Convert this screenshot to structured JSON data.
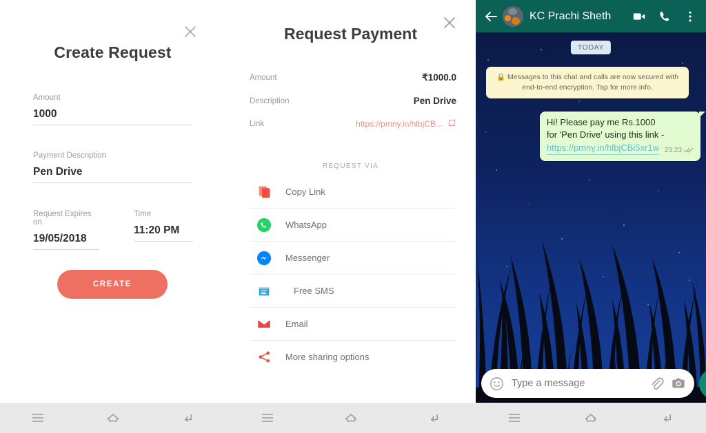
{
  "panel_create_request": {
    "title": "Create Request",
    "close_icon": "close-icon",
    "fields": [
      {
        "label": "Amount",
        "value": "1000"
      },
      {
        "label": "Payment Description",
        "value": "Pen Drive"
      },
      {
        "label": "Request Expires on",
        "value": "19/05/2018"
      },
      {
        "label": "Time",
        "value": "11:20 PM"
      }
    ],
    "submit_label": "CREATE",
    "accent_color": "#ef6f61"
  },
  "panel_request_payment": {
    "title": "Request Payment",
    "close_icon": "close-icon",
    "details": [
      {
        "label": "Amount",
        "value": "₹1000.0"
      },
      {
        "label": "Description",
        "value": "Pen Drive"
      },
      {
        "label": "Link",
        "value": "https://pmny.in/hlbjCB...",
        "icon": "external-link-icon"
      }
    ],
    "section_label": "REQUEST VIA",
    "share_options": [
      {
        "label": "Copy Link",
        "icon": "copy-icon",
        "color": "#ef6f61"
      },
      {
        "label": "WhatsApp",
        "icon": "whatsapp-icon",
        "color": "#25d366"
      },
      {
        "label": "Messenger",
        "icon": "messenger-icon",
        "color": "#0084ff"
      },
      {
        "label": "Free SMS",
        "icon": "sms-icon",
        "color": "#2aa8e8"
      },
      {
        "label": "Email",
        "icon": "gmail-icon",
        "color": "#e8453c"
      },
      {
        "label": "More sharing options",
        "icon": "share-icon",
        "color": "#ef4b3c"
      }
    ],
    "link_color": "#ef8b80"
  },
  "panel_whatsapp": {
    "header": {
      "back_icon": "back-arrow-icon",
      "avatar": "contact-avatar",
      "contact_name": "KC Prachi Sheth",
      "video_icon": "video-call-icon",
      "call_icon": "phone-call-icon",
      "menu_icon": "overflow-menu-icon",
      "background_color": "#0c6157"
    },
    "day_divider": "TODAY",
    "encryption_notice": "Messages to this chat and calls are now secured with end-to-end encryption. Tap for more info.",
    "encryption_lock_icon": "lock-icon",
    "message": {
      "line1": "Hi! Please pay me Rs.1000",
      "line2": "for 'Pen Drive' using this link -",
      "link": "https://pmny.in/hlbjCBi5xr1w",
      "time": "23:23",
      "status_icon": "double-check-icon"
    },
    "input": {
      "placeholder": "Type a message",
      "value": "",
      "emoji_icon": "emoji-icon",
      "attach_icon": "attachment-icon",
      "camera_icon": "camera-icon",
      "mic_icon": "microphone-icon"
    }
  },
  "nav_bar": {
    "menu_icon": "recents-icon",
    "home_icon": "home-icon",
    "back_icon": "back-icon"
  }
}
